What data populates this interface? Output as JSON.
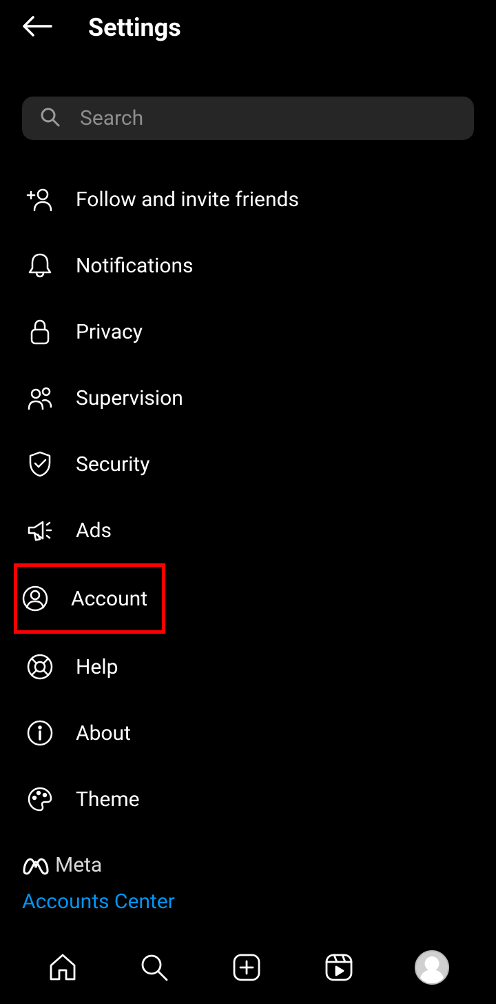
{
  "header": {
    "title": "Settings"
  },
  "search": {
    "placeholder": "Search"
  },
  "menu": {
    "items": [
      {
        "label": "Follow and invite friends"
      },
      {
        "label": "Notifications"
      },
      {
        "label": "Privacy"
      },
      {
        "label": "Supervision"
      },
      {
        "label": "Security"
      },
      {
        "label": "Ads"
      },
      {
        "label": "Account"
      },
      {
        "label": "Help"
      },
      {
        "label": "About"
      },
      {
        "label": "Theme"
      }
    ]
  },
  "meta": {
    "brand": "Meta",
    "link": "Accounts Center"
  }
}
